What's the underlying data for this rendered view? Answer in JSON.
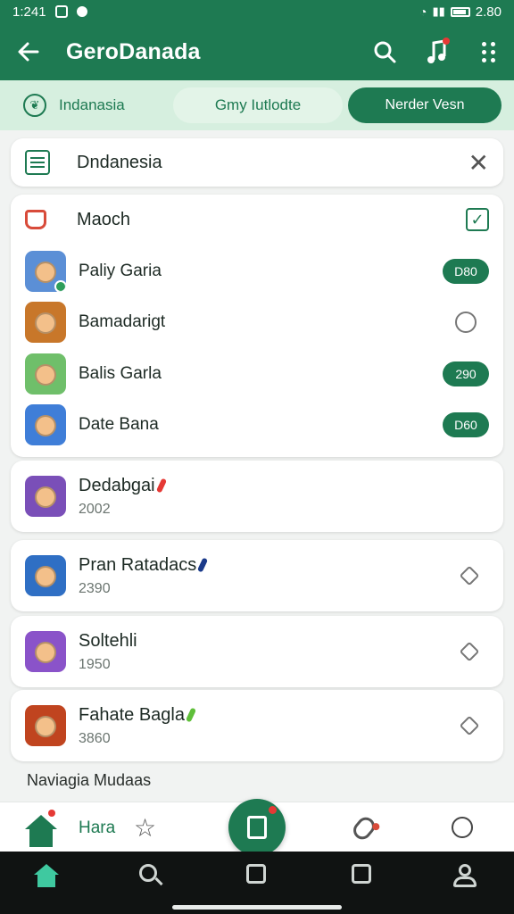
{
  "status_bar": {
    "time": "1:241",
    "battery": "2.80"
  },
  "app_bar": {
    "title": "GeroDanada",
    "back_icon": "arrow-left-icon",
    "actions": [
      "search-icon",
      "music-icon",
      "grid-menu-icon"
    ]
  },
  "tabs": [
    {
      "label": "Indanasia",
      "icon": "leaf-icon"
    },
    {
      "label": "Gmy Iutlodte"
    },
    {
      "label": "Nerder Vesn",
      "selected": true
    }
  ],
  "search": {
    "value": "Dndanesia",
    "clear_icon": "close-icon"
  },
  "match_group": {
    "title": "Maoch",
    "checked": true,
    "games": [
      {
        "name": "Paliy Garia",
        "pill": "D80",
        "thumb_color": "#5b8fd6"
      },
      {
        "name": "Bamadarigt",
        "thumb_color": "#c8772a"
      },
      {
        "name": "Balis Garla",
        "pill": "290",
        "thumb_color": "#6fbf6a"
      },
      {
        "name": "Date Bana",
        "pill": "D60",
        "thumb_color": "#3f7ed8"
      }
    ]
  },
  "items": [
    {
      "name": "Dedabgai",
      "sub": "2002",
      "mark_color": "#e53935",
      "thumb_color": "#7a4fb8"
    },
    {
      "name": "Pran Ratadacs",
      "sub": "2390",
      "mark_color": "#1a3a8a",
      "thumb_color": "#2f6fc4"
    },
    {
      "name": "Soltehli",
      "sub": "1950",
      "mark_color": "",
      "thumb_color": "#8a53c9"
    },
    {
      "name": "Fahate Bagla",
      "sub": "3860",
      "mark_color": "#5fbf3a",
      "thumb_color": "#c0441f"
    }
  ],
  "section_label": "Naviagia Mudaas",
  "bottom_nav": {
    "home_label": "Hara"
  },
  "colors": {
    "primary": "#1e7a52",
    "tab_bg": "#d6efdf",
    "accent_red": "#e53935"
  }
}
